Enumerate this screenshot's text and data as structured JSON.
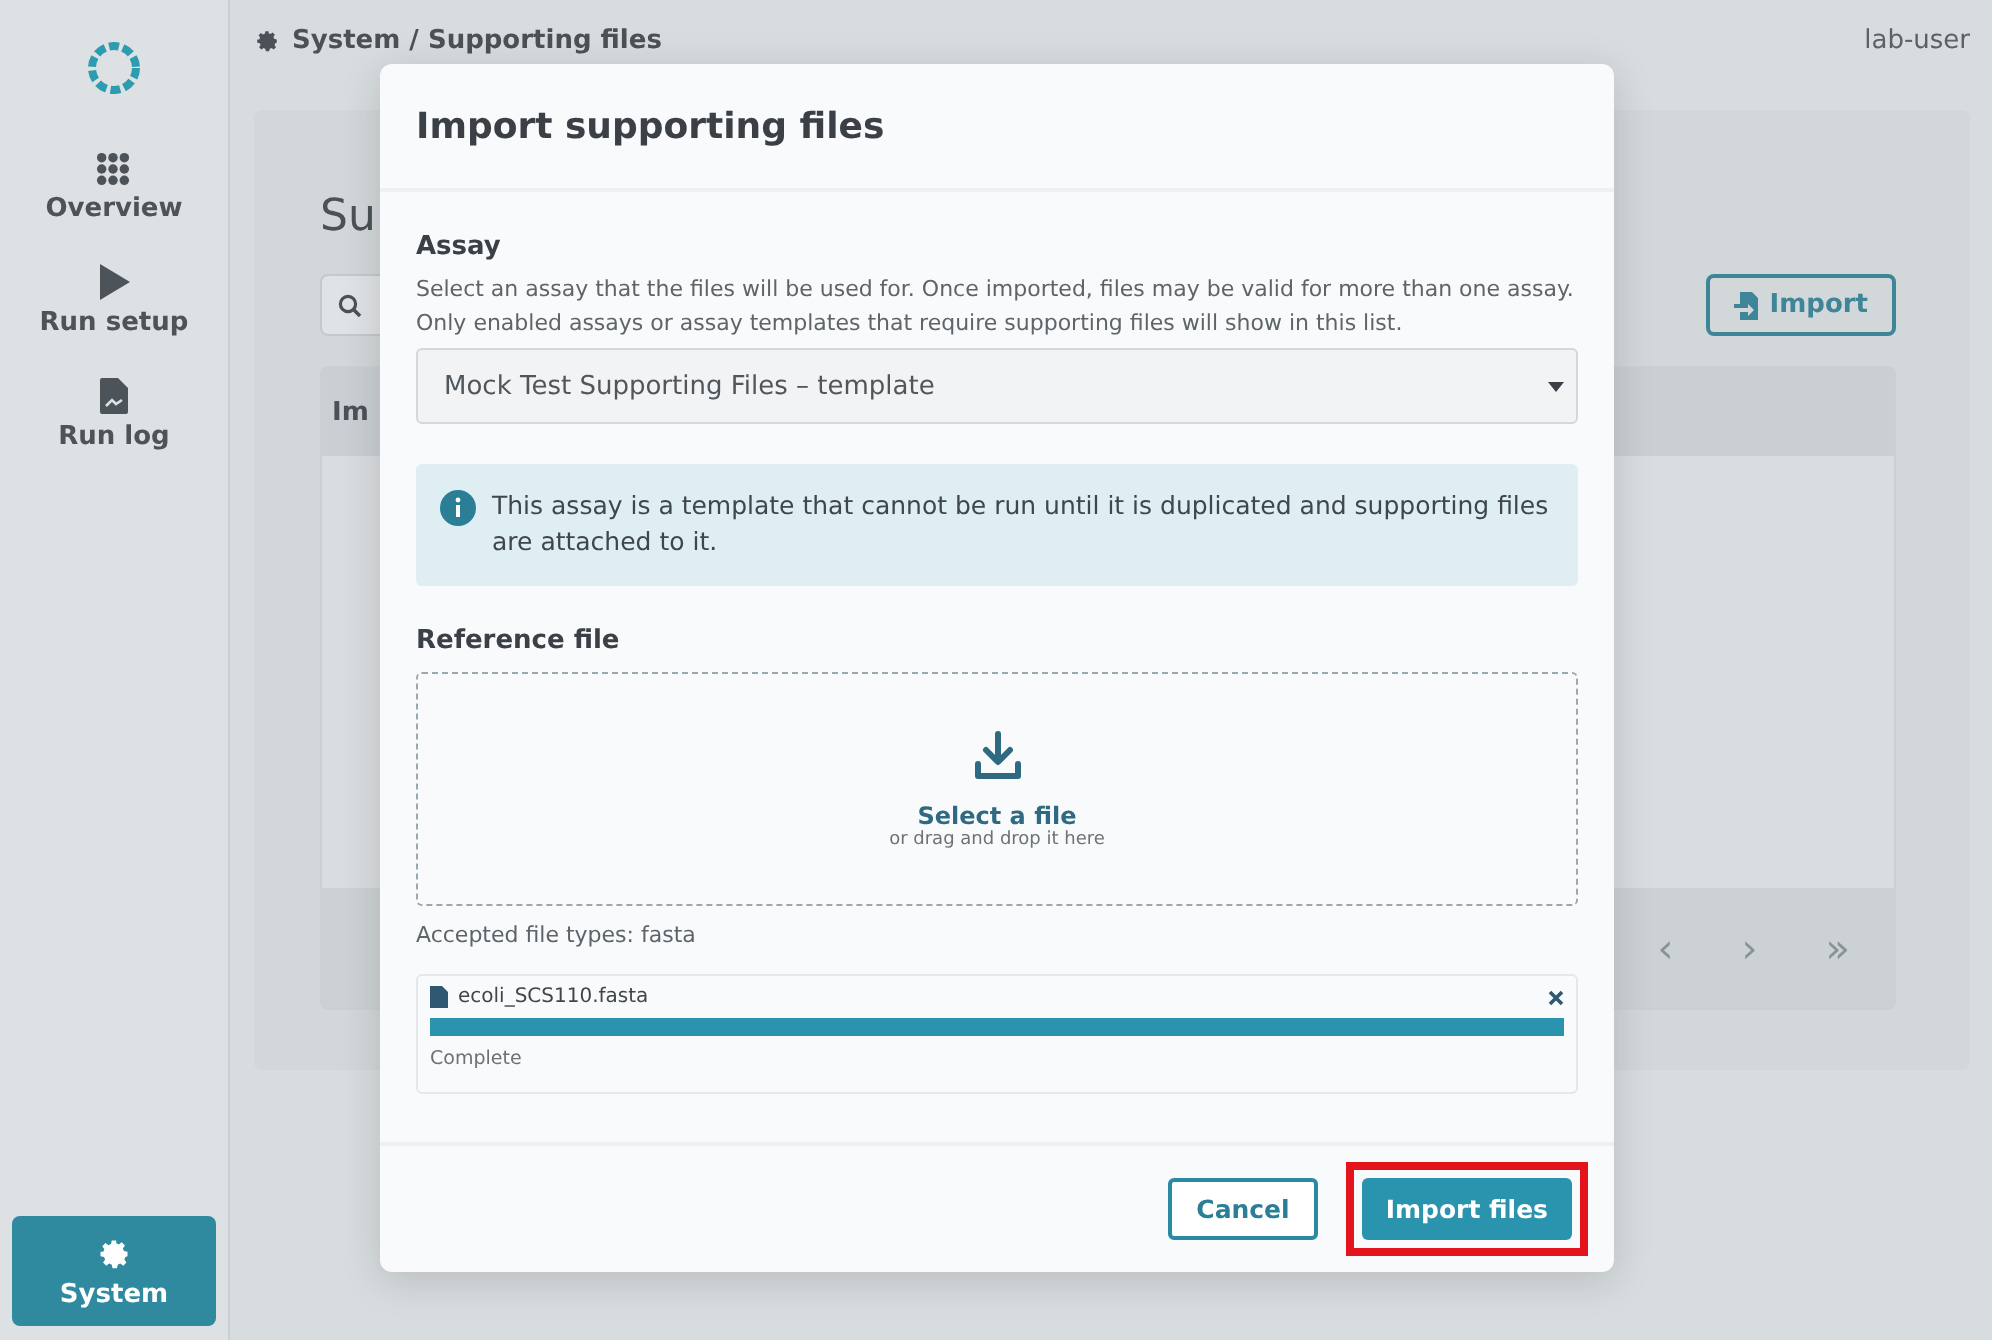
{
  "sidebar": {
    "items": [
      {
        "label": "Overview",
        "selected": false
      },
      {
        "label": "Run setup",
        "selected": false
      },
      {
        "label": "Run log",
        "selected": false
      }
    ],
    "bottom_item": {
      "label": "System",
      "selected": true
    }
  },
  "header": {
    "breadcrumb": "System / Supporting files",
    "user": "lab-user"
  },
  "page": {
    "title": "Su",
    "import_button": "Import",
    "table": {
      "column_1": "Im"
    },
    "pagination": [
      "‹",
      "›",
      "»"
    ]
  },
  "dialog": {
    "title": "Import supporting files",
    "assay": {
      "label": "Assay",
      "help": [
        "Select an assay that the files will be used for. Once imported, files may be valid for more than one assay.",
        "Only enabled assays or assay templates that require supporting files will show in this list."
      ],
      "value": "Mock Test Supporting Files – template"
    },
    "info": "This assay is a template that cannot be run until it is duplicated and supporting files are attached to it.",
    "reference": {
      "label": "Reference file",
      "drop_title": "Select a file",
      "drop_hint": "or drag and drop it here",
      "accepted": "Accepted file types: fasta"
    },
    "upload": {
      "name": "ecoli_SCS110.fasta",
      "level": 1,
      "status": "Complete"
    },
    "buttons": [
      {
        "label": "Cancel",
        "kind": "secondary",
        "highlighted": false
      },
      {
        "label": "Import files",
        "kind": "primary",
        "highlighted": true
      }
    ]
  }
}
